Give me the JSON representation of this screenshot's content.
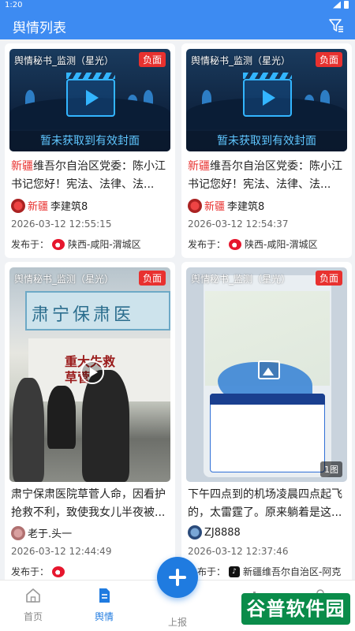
{
  "status_bar": {
    "time": "1:20"
  },
  "header": {
    "title": "舆情列表",
    "filter_icon": "filter-icon"
  },
  "cards": [
    {
      "source": "舆情秘书_监测（星光）",
      "tag": "负面",
      "cover_text": "暂未获取到有效封面",
      "title_highlight": "新疆",
      "title_rest": "维吾尔自治区党委：陈小江书记您好！宪法、法律、法...",
      "author_highlight": "新疆",
      "author_rest": "李建筑8",
      "time": "2026-03-12 12:55:15",
      "pub_label": "发布于：",
      "platform_icon": "weibo-icon",
      "location": "陕西-咸阳-渭城区"
    },
    {
      "source": "舆情秘书_监测（星光）",
      "tag": "负面",
      "cover_text": "暂未获取到有效封面",
      "title_highlight": "新疆",
      "title_rest": "维吾尔自治区党委：陈小江书记您好！宪法、法律、法...",
      "author_highlight": "新疆",
      "author_rest": "李建筑8",
      "time": "2026-03-12 12:54:37",
      "pub_label": "发布于：",
      "platform_icon": "weibo-icon",
      "location": "陕西-咸阳-渭城区"
    },
    {
      "source": "舆情秘书_监测（星光）",
      "tag": "负面",
      "photo_banner": "肃宁保肃医",
      "photo_red_text": "重大失救\n草菅人命",
      "title": "肃宁保肃医院草菅人命，因看护抢救不利，致使我女儿半夜被...",
      "author": "老于.头一",
      "time": "2026-03-12 12:44:49",
      "pub_label": "发布于："
    },
    {
      "source": "舆情秘书_监测（星光）",
      "tag": "负面",
      "image_count": "1图",
      "title": "下午四点到的机场凌晨四点起飞的，太雷霆了。原来躺着是这...",
      "author": "ZJ8888",
      "time": "2026-03-12 12:37:46",
      "pub_label": "发布于：",
      "platform_icon": "douyin-icon",
      "location": "新疆维吾尔自治区-阿克"
    }
  ],
  "tabbar": {
    "home": "首页",
    "sentiment": "舆情",
    "report": "上报"
  },
  "watermark": "谷普软件园",
  "colors": {
    "primary": "#1f7be0",
    "header": "#3d8bf2",
    "negative": "#e8312f"
  }
}
